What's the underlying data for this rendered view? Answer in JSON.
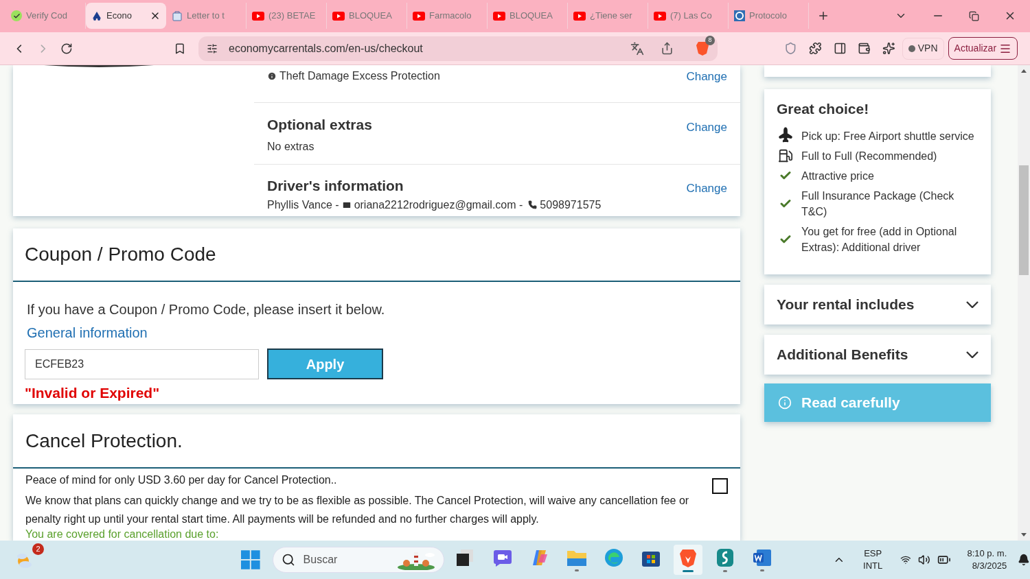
{
  "browser": {
    "tabs": [
      {
        "title": "Verify Cod",
        "kind": "check",
        "selected": false
      },
      {
        "title": "Econo",
        "kind": "logo",
        "selected": true
      },
      {
        "title": "Letter to t",
        "kind": "doc",
        "selected": false
      },
      {
        "title": "(23) BETAE",
        "kind": "video",
        "selected": false
      },
      {
        "title": "BLOQUEA",
        "kind": "video",
        "selected": false
      },
      {
        "title": "Farmacolo",
        "kind": "video",
        "selected": false
      },
      {
        "title": "BLOQUEA",
        "kind": "video",
        "selected": false
      },
      {
        "title": "¿Tiene ser",
        "kind": "video",
        "selected": false
      },
      {
        "title": "(7) Las Co",
        "kind": "video",
        "selected": false
      },
      {
        "title": "Protocolo",
        "kind": "loop",
        "selected": false
      }
    ],
    "url": "economycarrentals.com/en-us/checkout",
    "shields_count": "8",
    "vpn": "VPN",
    "update": "Actualizar"
  },
  "summary": {
    "rows": [
      {
        "kind": "info",
        "text": "Theft Damage Excess Protection",
        "action": "Change"
      },
      {
        "kind": "section",
        "title": "Optional extras",
        "text": "No extras",
        "action": "Change"
      },
      {
        "kind": "driver",
        "title": "Driver's information",
        "name": "Phyllis Vance -",
        "email": "oriana2212rodriguez@gmail.com -",
        "phone": "5098971575",
        "action": "Change"
      }
    ]
  },
  "coupon": {
    "title": "Coupon / Promo Code",
    "hint": "If you have a Coupon / Promo Code, please insert it below.",
    "link": "General information",
    "value": "ECFEB23",
    "button": "Apply",
    "error": "\"Invalid or Expired\""
  },
  "cancel": {
    "title": "Cancel Protection.",
    "price": "Peace of mind for only USD 3.60 per day for Cancel Protection..",
    "checked": false,
    "body": "We know that plans can quickly change and we try to be as flexible as possible. The Cancel Protection, will waive any cancellation fee or penalty right up until your rental start time. All payments will be refunded and no further charges will apply.",
    "covered": "You are covered for cancellation due to:"
  },
  "sidebar": {
    "title": "Great choice!",
    "features": [
      {
        "kind": "plane",
        "text": "Pick up: Free Airport shuttle service"
      },
      {
        "kind": "fuel",
        "text": "Full to Full (Recommended)"
      },
      {
        "kind": "check",
        "text": "Attractive price"
      },
      {
        "kind": "check",
        "text": "Full Insurance Package (Check T&C)"
      },
      {
        "kind": "check",
        "text": "You get for free (add in Optional Extras): Additional driver"
      }
    ],
    "panels": [
      {
        "title": "Your rental includes",
        "expanded": false
      },
      {
        "title": "Additional Benefits",
        "expanded": false
      }
    ],
    "notice": "Read carefully"
  },
  "taskbar": {
    "weather_badge": "2",
    "search": "Buscar",
    "apps": [
      {
        "kind": "taskview",
        "running": false
      },
      {
        "kind": "chat",
        "running": false
      },
      {
        "kind": "copilot",
        "running": false
      },
      {
        "kind": "files",
        "running": true
      },
      {
        "kind": "edge",
        "running": false
      },
      {
        "kind": "store",
        "running": false
      },
      {
        "kind": "brave",
        "running": true
      },
      {
        "kind": "vpn",
        "running": true
      },
      {
        "kind": "word",
        "running": true
      }
    ],
    "language": "ESP",
    "layout": "INTL",
    "time": "8:10 p. m.",
    "date": "8/3/2025"
  }
}
